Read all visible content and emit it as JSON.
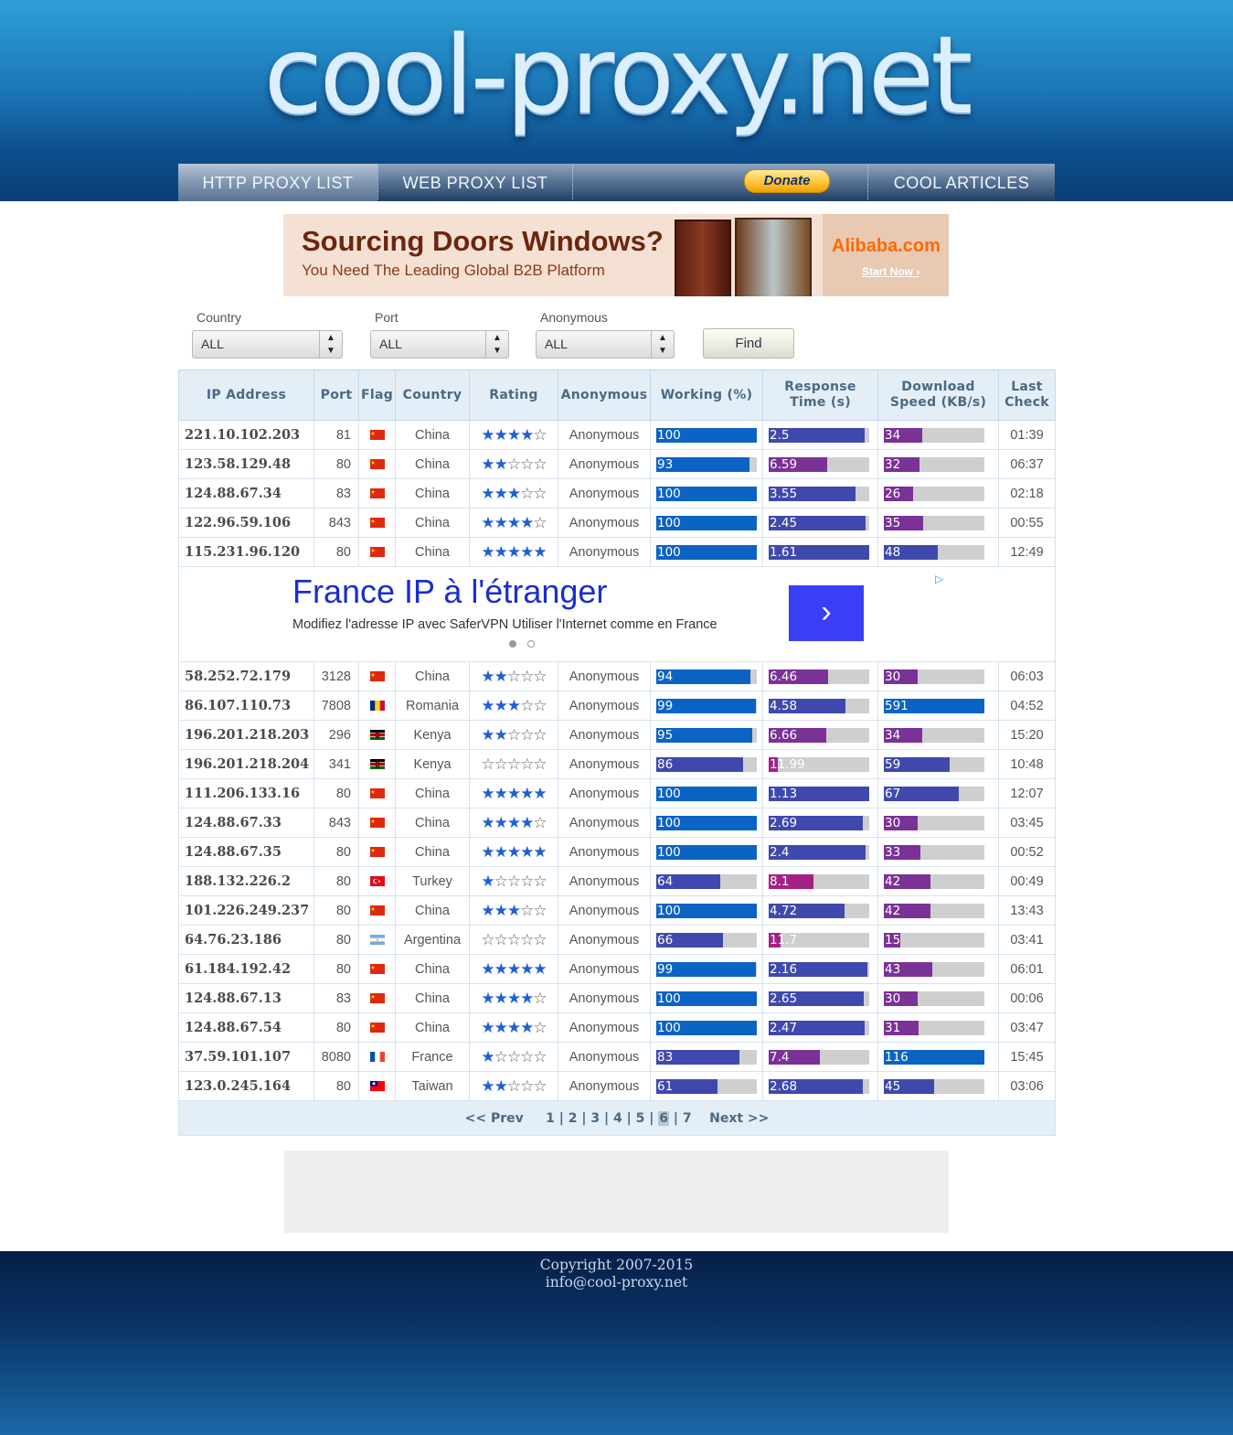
{
  "header": {
    "logo_text": "cool-proxy.net",
    "nav": [
      {
        "label": "HTTP PROXY LIST",
        "active": true
      },
      {
        "label": "WEB PROXY LIST",
        "active": false
      },
      {
        "label": "Donate",
        "type": "paypal-button"
      },
      {
        "label": "COOL ARTICLES",
        "active": false
      }
    ]
  },
  "top_banner": {
    "headline": "Sourcing Doors  Windows?",
    "subline": "You Need The Leading Global B2B Platform",
    "brand": "Alibaba.com",
    "cta": "Start Now ›"
  },
  "filters": {
    "country": {
      "label": "Country",
      "value": "ALL"
    },
    "port": {
      "label": "Port",
      "value": "ALL"
    },
    "anonymous": {
      "label": "Anonymous",
      "value": "ALL"
    },
    "find_label": "Find"
  },
  "table": {
    "headers": [
      "IP Address",
      "Port",
      "Flag",
      "Country",
      "Rating",
      "Anonymous",
      "Working (%)",
      "Response Time (s)",
      "Download Speed (KB/s)",
      "Last Check"
    ],
    "colors": {
      "bar_bg": "#cfcfcf",
      "blue": "#0b63c4",
      "indigo": "#3f49ad",
      "purple": "#7a3296",
      "magenta": "#a32184"
    },
    "rows_before_ad": [
      {
        "ip": "221.10.102.203",
        "port": "81",
        "flag": "cn-flag",
        "country": "China",
        "rating": 4,
        "anon": "Anonymous",
        "working": "100",
        "resp": "2.5",
        "dl": "34",
        "last": "01:39"
      },
      {
        "ip": "123.58.129.48",
        "port": "80",
        "flag": "cn-flag",
        "country": "China",
        "rating": 2,
        "anon": "Anonymous",
        "working": "93",
        "resp": "6.59",
        "dl": "32",
        "last": "06:37"
      },
      {
        "ip": "124.88.67.34",
        "port": "83",
        "flag": "cn-flag",
        "country": "China",
        "rating": 3,
        "anon": "Anonymous",
        "working": "100",
        "resp": "3.55",
        "dl": "26",
        "last": "02:18"
      },
      {
        "ip": "122.96.59.106",
        "port": "843",
        "flag": "cn-flag",
        "country": "China",
        "rating": 4,
        "anon": "Anonymous",
        "working": "100",
        "resp": "2.45",
        "dl": "35",
        "last": "00:55"
      },
      {
        "ip": "115.231.96.120",
        "port": "80",
        "flag": "cn-flag",
        "country": "China",
        "rating": 5,
        "anon": "Anonymous",
        "working": "100",
        "resp": "1.61",
        "dl": "48",
        "last": "12:49"
      }
    ],
    "inline_ad": {
      "title": "France IP à l'étranger",
      "text": "Modifiez l'adresse IP avec SaferVPN Utiliser l'Internet comme en France",
      "button_icon": "chevron-right-icon",
      "ad_choices_icon": "adchoices-icon"
    },
    "rows_after_ad": [
      {
        "ip": "58.252.72.179",
        "port": "3128",
        "flag": "cn-flag",
        "country": "China",
        "rating": 2,
        "anon": "Anonymous",
        "working": "94",
        "resp": "6.46",
        "dl": "30",
        "last": "06:03"
      },
      {
        "ip": "86.107.110.73",
        "port": "7808",
        "flag": "ro-flag",
        "country": "Romania",
        "rating": 3,
        "anon": "Anonymous",
        "working": "99",
        "resp": "4.58",
        "dl": "591",
        "last": "04:52"
      },
      {
        "ip": "196.201.218.203",
        "port": "296",
        "flag": "ke-flag",
        "country": "Kenya",
        "rating": 2,
        "anon": "Anonymous",
        "working": "95",
        "resp": "6.66",
        "dl": "34",
        "last": "15:20"
      },
      {
        "ip": "196.201.218.204",
        "port": "341",
        "flag": "ke-flag",
        "country": "Kenya",
        "rating": 0,
        "anon": "Anonymous",
        "working": "86",
        "resp": "11.99",
        "dl": "59",
        "last": "10:48"
      },
      {
        "ip": "111.206.133.16",
        "port": "80",
        "flag": "cn-flag",
        "country": "China",
        "rating": 5,
        "anon": "Anonymous",
        "working": "100",
        "resp": "1.13",
        "dl": "67",
        "last": "12:07"
      },
      {
        "ip": "124.88.67.33",
        "port": "843",
        "flag": "cn-flag",
        "country": "China",
        "rating": 4,
        "anon": "Anonymous",
        "working": "100",
        "resp": "2.69",
        "dl": "30",
        "last": "03:45"
      },
      {
        "ip": "124.88.67.35",
        "port": "80",
        "flag": "cn-flag",
        "country": "China",
        "rating": 5,
        "anon": "Anonymous",
        "working": "100",
        "resp": "2.4",
        "dl": "33",
        "last": "00:52"
      },
      {
        "ip": "188.132.226.2",
        "port": "80",
        "flag": "tr-flag",
        "country": "Turkey",
        "rating": 1,
        "anon": "Anonymous",
        "working": "64",
        "resp": "8.1",
        "dl": "42",
        "last": "00:49"
      },
      {
        "ip": "101.226.249.237",
        "port": "80",
        "flag": "cn-flag",
        "country": "China",
        "rating": 3,
        "anon": "Anonymous",
        "working": "100",
        "resp": "4.72",
        "dl": "42",
        "last": "13:43"
      },
      {
        "ip": "64.76.23.186",
        "port": "80",
        "flag": "ar-flag",
        "country": "Argentina",
        "rating": 0,
        "anon": "Anonymous",
        "working": "66",
        "resp": "11.7",
        "dl": "15",
        "last": "03:41"
      },
      {
        "ip": "61.184.192.42",
        "port": "80",
        "flag": "cn-flag",
        "country": "China",
        "rating": 5,
        "anon": "Anonymous",
        "working": "99",
        "resp": "2.16",
        "dl": "43",
        "last": "06:01"
      },
      {
        "ip": "124.88.67.13",
        "port": "83",
        "flag": "cn-flag",
        "country": "China",
        "rating": 4,
        "anon": "Anonymous",
        "working": "100",
        "resp": "2.65",
        "dl": "30",
        "last": "00:06"
      },
      {
        "ip": "124.88.67.54",
        "port": "80",
        "flag": "cn-flag",
        "country": "China",
        "rating": 4,
        "anon": "Anonymous",
        "working": "100",
        "resp": "2.47",
        "dl": "31",
        "last": "03:47"
      },
      {
        "ip": "37.59.101.107",
        "port": "8080",
        "flag": "fr-flag",
        "country": "France",
        "rating": 1,
        "anon": "Anonymous",
        "working": "83",
        "resp": "7.4",
        "dl": "116",
        "last": "15:45"
      },
      {
        "ip": "123.0.245.164",
        "port": "80",
        "flag": "tw-flag",
        "country": "Taiwan",
        "rating": 2,
        "anon": "Anonymous",
        "working": "61",
        "resp": "2.68",
        "dl": "45",
        "last": "03:06"
      }
    ],
    "pagination": {
      "prev": "<< Prev",
      "pages": [
        "1",
        "2",
        "3",
        "4",
        "5",
        "6",
        "7"
      ],
      "current": "6",
      "next": "Next >>"
    }
  },
  "footer": {
    "copyright": "Copyright 2007-2015",
    "email": "info@cool-proxy.net"
  }
}
